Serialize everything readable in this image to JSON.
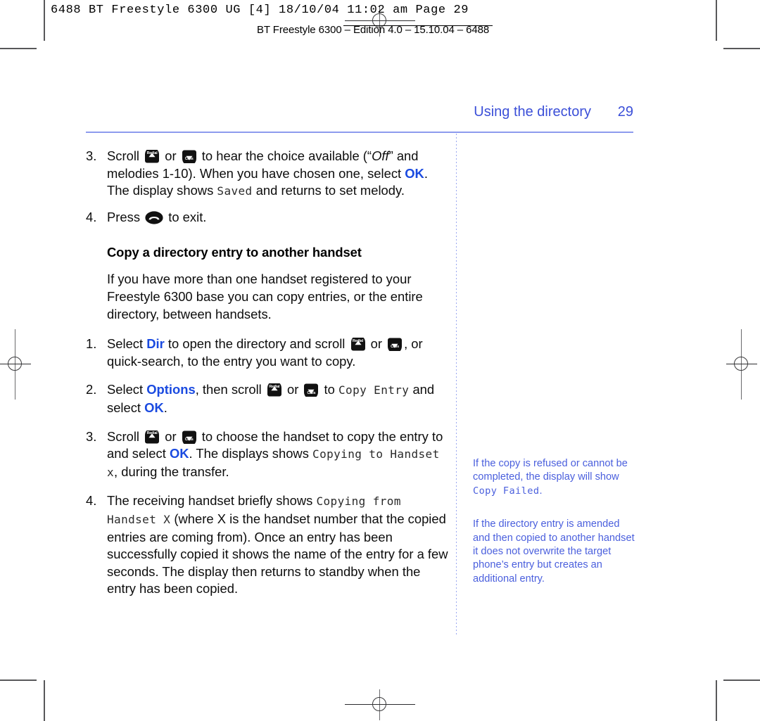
{
  "prepress": {
    "slug_line": "6488 BT Freestyle 6300 UG [4]  18/10/04  11:02 am  Page 29",
    "slug_sub": "BT Freestyle 6300 – Edition 4.0 – 15.10.04 – 6488"
  },
  "running_head": {
    "section": "Using the directory",
    "folio": "29",
    "color": "#3b4fd8"
  },
  "icons": {
    "up_key_label": "Redial",
    "down_key_label": "Calls",
    "end_key_name": "end-call-key"
  },
  "main": {
    "step3": {
      "num": "3.",
      "t1": "Scroll ",
      "t2": " or ",
      "t3": " to hear the choice available (“",
      "off": "Off",
      "t4": "” and melodies 1-10). When you have chosen one, select ",
      "ok": "OK",
      "t5": ". The display shows ",
      "saved": "Saved",
      "t6": " and returns to set melody."
    },
    "step4": {
      "num": "4.",
      "t1": "Press ",
      "t2": " to exit."
    },
    "subhead": "Copy a directory entry to another handset",
    "intro": "If you have more than one handset registered to your Freestyle 6300 base you can copy entries, or the entire directory, between handsets.",
    "item1": {
      "num": "1.",
      "t1": "Select ",
      "dir": "Dir",
      "t2": " to open the directory and scroll ",
      "t3": " or ",
      "t4": ", or quick-search, to the entry you want to copy."
    },
    "item2": {
      "num": "2.",
      "t1": "Select ",
      "options": "Options",
      "t2": ", then scroll ",
      "t3": " or ",
      "t4": " to ",
      "copy_entry": "Copy Entry",
      "t5": " and select ",
      "ok": "OK",
      "t6": "."
    },
    "item3": {
      "num": "3.",
      "t1": "Scroll ",
      "t2": " or ",
      "t3": " to choose the handset to copy the entry to and select ",
      "ok": "OK",
      "t4": ". The displays shows ",
      "copying_to": "Copying to Handset x",
      "t5": ", during the transfer."
    },
    "item4": {
      "num": "4.",
      "t1": "The receiving handset briefly shows ",
      "copying_from": "Copying from Handset X",
      "t2": " (where X is the handset number that the copied entries are coming from). Once an entry has been successfully copied it shows the name of the entry for a few seconds. The display then returns to standby when the entry has been copied."
    }
  },
  "side_notes": [
    {
      "t1": "If the copy is refused or cannot be completed, the display will show ",
      "lcd": "Copy Failed",
      "t2": "."
    },
    {
      "t1": "If the directory entry is amended and then copied to another handset it does not overwrite the target phone’s entry but creates an additional entry.",
      "lcd": "",
      "t2": ""
    }
  ]
}
